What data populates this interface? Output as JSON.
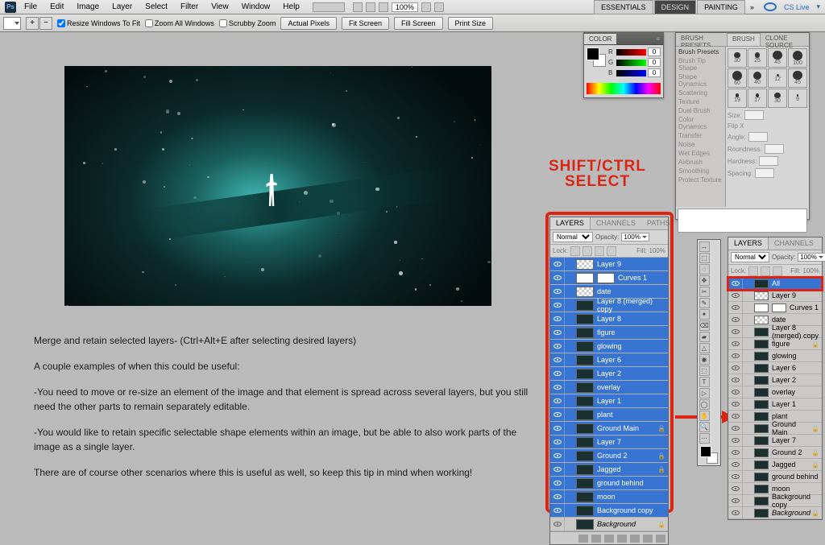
{
  "menu": {
    "items": [
      "File",
      "Edit",
      "Image",
      "Layer",
      "Select",
      "Filter",
      "View",
      "Window",
      "Help"
    ],
    "zoom": "100%",
    "workspaces": [
      "ESSENTIALS",
      "DESIGN",
      "PAINTING"
    ],
    "cslive": "CS Live"
  },
  "opt": {
    "resize": "Resize Windows To Fit",
    "zoomall": "Zoom All Windows",
    "scrubby": "Scrubby Zoom",
    "actual": "Actual Pixels",
    "fitscreen": "Fit Screen",
    "fillscreen": "Fill Screen",
    "print": "Print Size"
  },
  "tutorial": {
    "l1": "Merge and retain selected layers-   (Ctrl+Alt+E after selecting desired layers)",
    "l2": "A couple examples of when this could be useful:",
    "l3": "-You need to move or re-size an element of the image and that element is spread across several layers, but you still need the other parts to remain separately editable.",
    "l4": "-You would like to retain specific selectable shape elements within an image, but be able to also work parts of the image as a single layer.",
    "l5": "There are of course other scenarios where this is useful as well, so keep this tip in mind when working!"
  },
  "anno": {
    "l1": "SHIFT/CTRL",
    "l2": "SELECT"
  },
  "color": {
    "tab": "COLOR",
    "r": "R",
    "g": "G",
    "b": "B",
    "rv": "0",
    "gv": "0",
    "bv": "0"
  },
  "brush": {
    "tabs": [
      "BRUSH PRESETS",
      "BRUSH",
      "CLONE SOURCE"
    ],
    "preset": "Brush Presets",
    "opts": [
      "Brush Tip Shape",
      "Shape Dynamics",
      "Scattering",
      "Texture",
      "Dual Brush",
      "Color Dynamics",
      "Transfer",
      "Noise",
      "Wet Edges",
      "Airbrush",
      "Smoothing",
      "Protect Texture"
    ],
    "size": "Size:",
    "flip": "Flip X",
    "angle": "Angle:",
    "round": "Roundness:",
    "hard": "Hardness:",
    "space": "Spacing:",
    "sizes": [
      "30",
      "25",
      "45",
      "100",
      "60",
      "40",
      "12",
      "45",
      "19",
      "17",
      "30",
      "9"
    ]
  },
  "layers": {
    "tabs": [
      "LAYERS",
      "CHANNELS",
      "PATHS"
    ],
    "mode": "Normal",
    "opacity_l": "Opacity:",
    "fill_l": "Fill:",
    "opacity": "100%",
    "fill": "100%",
    "lock": "Lock:",
    "left": [
      {
        "n": "Layer 9",
        "t": "check",
        "s": 1
      },
      {
        "n": "Curves 1",
        "t": "white",
        "s": 1,
        "adj": 1
      },
      {
        "n": "date",
        "t": "check",
        "s": 1
      },
      {
        "n": "Layer 8 (merged) copy",
        "t": "dark",
        "s": 1
      },
      {
        "n": "Layer 8",
        "t": "dark",
        "s": 1
      },
      {
        "n": "figure",
        "t": "dark",
        "s": 1
      },
      {
        "n": "glowing",
        "t": "dark",
        "s": 1
      },
      {
        "n": "Layer 6",
        "t": "dark",
        "s": 1
      },
      {
        "n": "Layer 2",
        "t": "dark",
        "s": 1
      },
      {
        "n": "overlay",
        "t": "dark",
        "s": 1
      },
      {
        "n": "Layer 1",
        "t": "dark",
        "s": 1
      },
      {
        "n": "plant",
        "t": "dark",
        "s": 1
      },
      {
        "n": "Ground Main",
        "t": "dark",
        "s": 1,
        "lk": 1
      },
      {
        "n": "Layer 7",
        "t": "dark",
        "s": 1
      },
      {
        "n": "Ground 2",
        "t": "dark",
        "s": 1,
        "lk": 1
      },
      {
        "n": "Jagged",
        "t": "dark",
        "s": 1,
        "lk": 1
      },
      {
        "n": "ground behind",
        "t": "dark",
        "s": 1
      },
      {
        "n": "moon",
        "t": "dark",
        "s": 1
      },
      {
        "n": "Background copy",
        "t": "dark",
        "s": 1
      },
      {
        "n": "Background",
        "t": "dark",
        "s": 0,
        "it": 1,
        "lk": 1
      }
    ],
    "right_sel": "All",
    "right": [
      {
        "n": "Layer 9",
        "t": "check"
      },
      {
        "n": "Curves 1",
        "t": "white",
        "adj": 1
      },
      {
        "n": "date",
        "t": "check"
      },
      {
        "n": "Layer 8 (merged) copy",
        "t": "dark"
      },
      {
        "n": "figure",
        "t": "dark",
        "lk": 1
      },
      {
        "n": "glowing",
        "t": "dark"
      },
      {
        "n": "Layer 6",
        "t": "dark"
      },
      {
        "n": "Layer 2",
        "t": "dark"
      },
      {
        "n": "overlay",
        "t": "dark"
      },
      {
        "n": "Layer 1",
        "t": "dark"
      },
      {
        "n": "plant",
        "t": "dark"
      },
      {
        "n": "Ground Main",
        "t": "dark",
        "lk": 1
      },
      {
        "n": "Layer 7",
        "t": "dark"
      },
      {
        "n": "Ground 2",
        "t": "dark",
        "lk": 1
      },
      {
        "n": "Jagged",
        "t": "dark",
        "lk": 1
      },
      {
        "n": "ground behind",
        "t": "dark"
      },
      {
        "n": "moon",
        "t": "dark"
      },
      {
        "n": "Background copy",
        "t": "dark"
      },
      {
        "n": "Background",
        "t": "dark",
        "it": 1,
        "lk": 1
      }
    ]
  },
  "tools": [
    "↔",
    "⬚",
    "◌",
    "✥",
    "✂",
    "✎",
    "✦",
    "⌫",
    "▰",
    "△",
    "◉",
    "⬚",
    "T",
    "▷",
    "◯",
    "✋",
    "🔍",
    "⋯"
  ]
}
